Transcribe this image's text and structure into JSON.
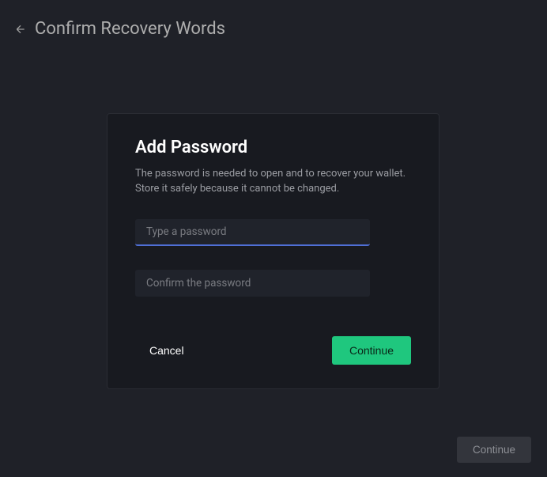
{
  "header": {
    "title": "Confirm Recovery Words"
  },
  "modal": {
    "title": "Add Password",
    "description": "The password is needed to open and to recover your wallet. Store it safely because it cannot be changed.",
    "password_placeholder": "Type a password",
    "confirm_placeholder": "Confirm the password",
    "cancel_label": "Cancel",
    "continue_label": "Continue"
  },
  "footer": {
    "continue_label": "Continue"
  }
}
